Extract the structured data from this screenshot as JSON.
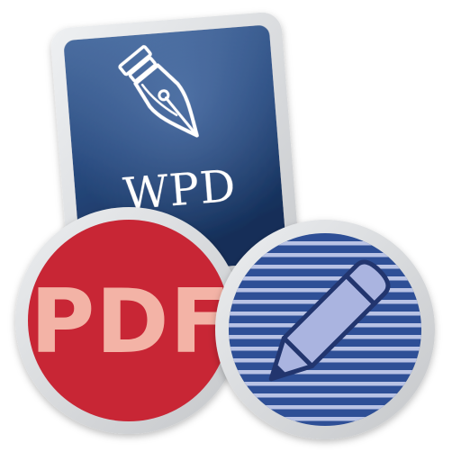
{
  "icon": {
    "document_card": {
      "label": "WPD",
      "icon": "fountain-pen-nib-icon",
      "colors": {
        "frame": "#dadcde",
        "body_top": "#3f6294",
        "body_bottom": "#14315d",
        "glyph": "#ffffff"
      }
    },
    "pdf_badge": {
      "label": "PDF",
      "colors": {
        "ring": "#d8d9db",
        "fill": "#c82535",
        "text": "#f3b3a6"
      }
    },
    "edit_badge": {
      "icon": "pencil-icon",
      "colors": {
        "ring": "#d8d9db",
        "fill": "#2e4f96",
        "stripes": "#b7c1e3",
        "pencil": "#aab4e0"
      }
    }
  }
}
